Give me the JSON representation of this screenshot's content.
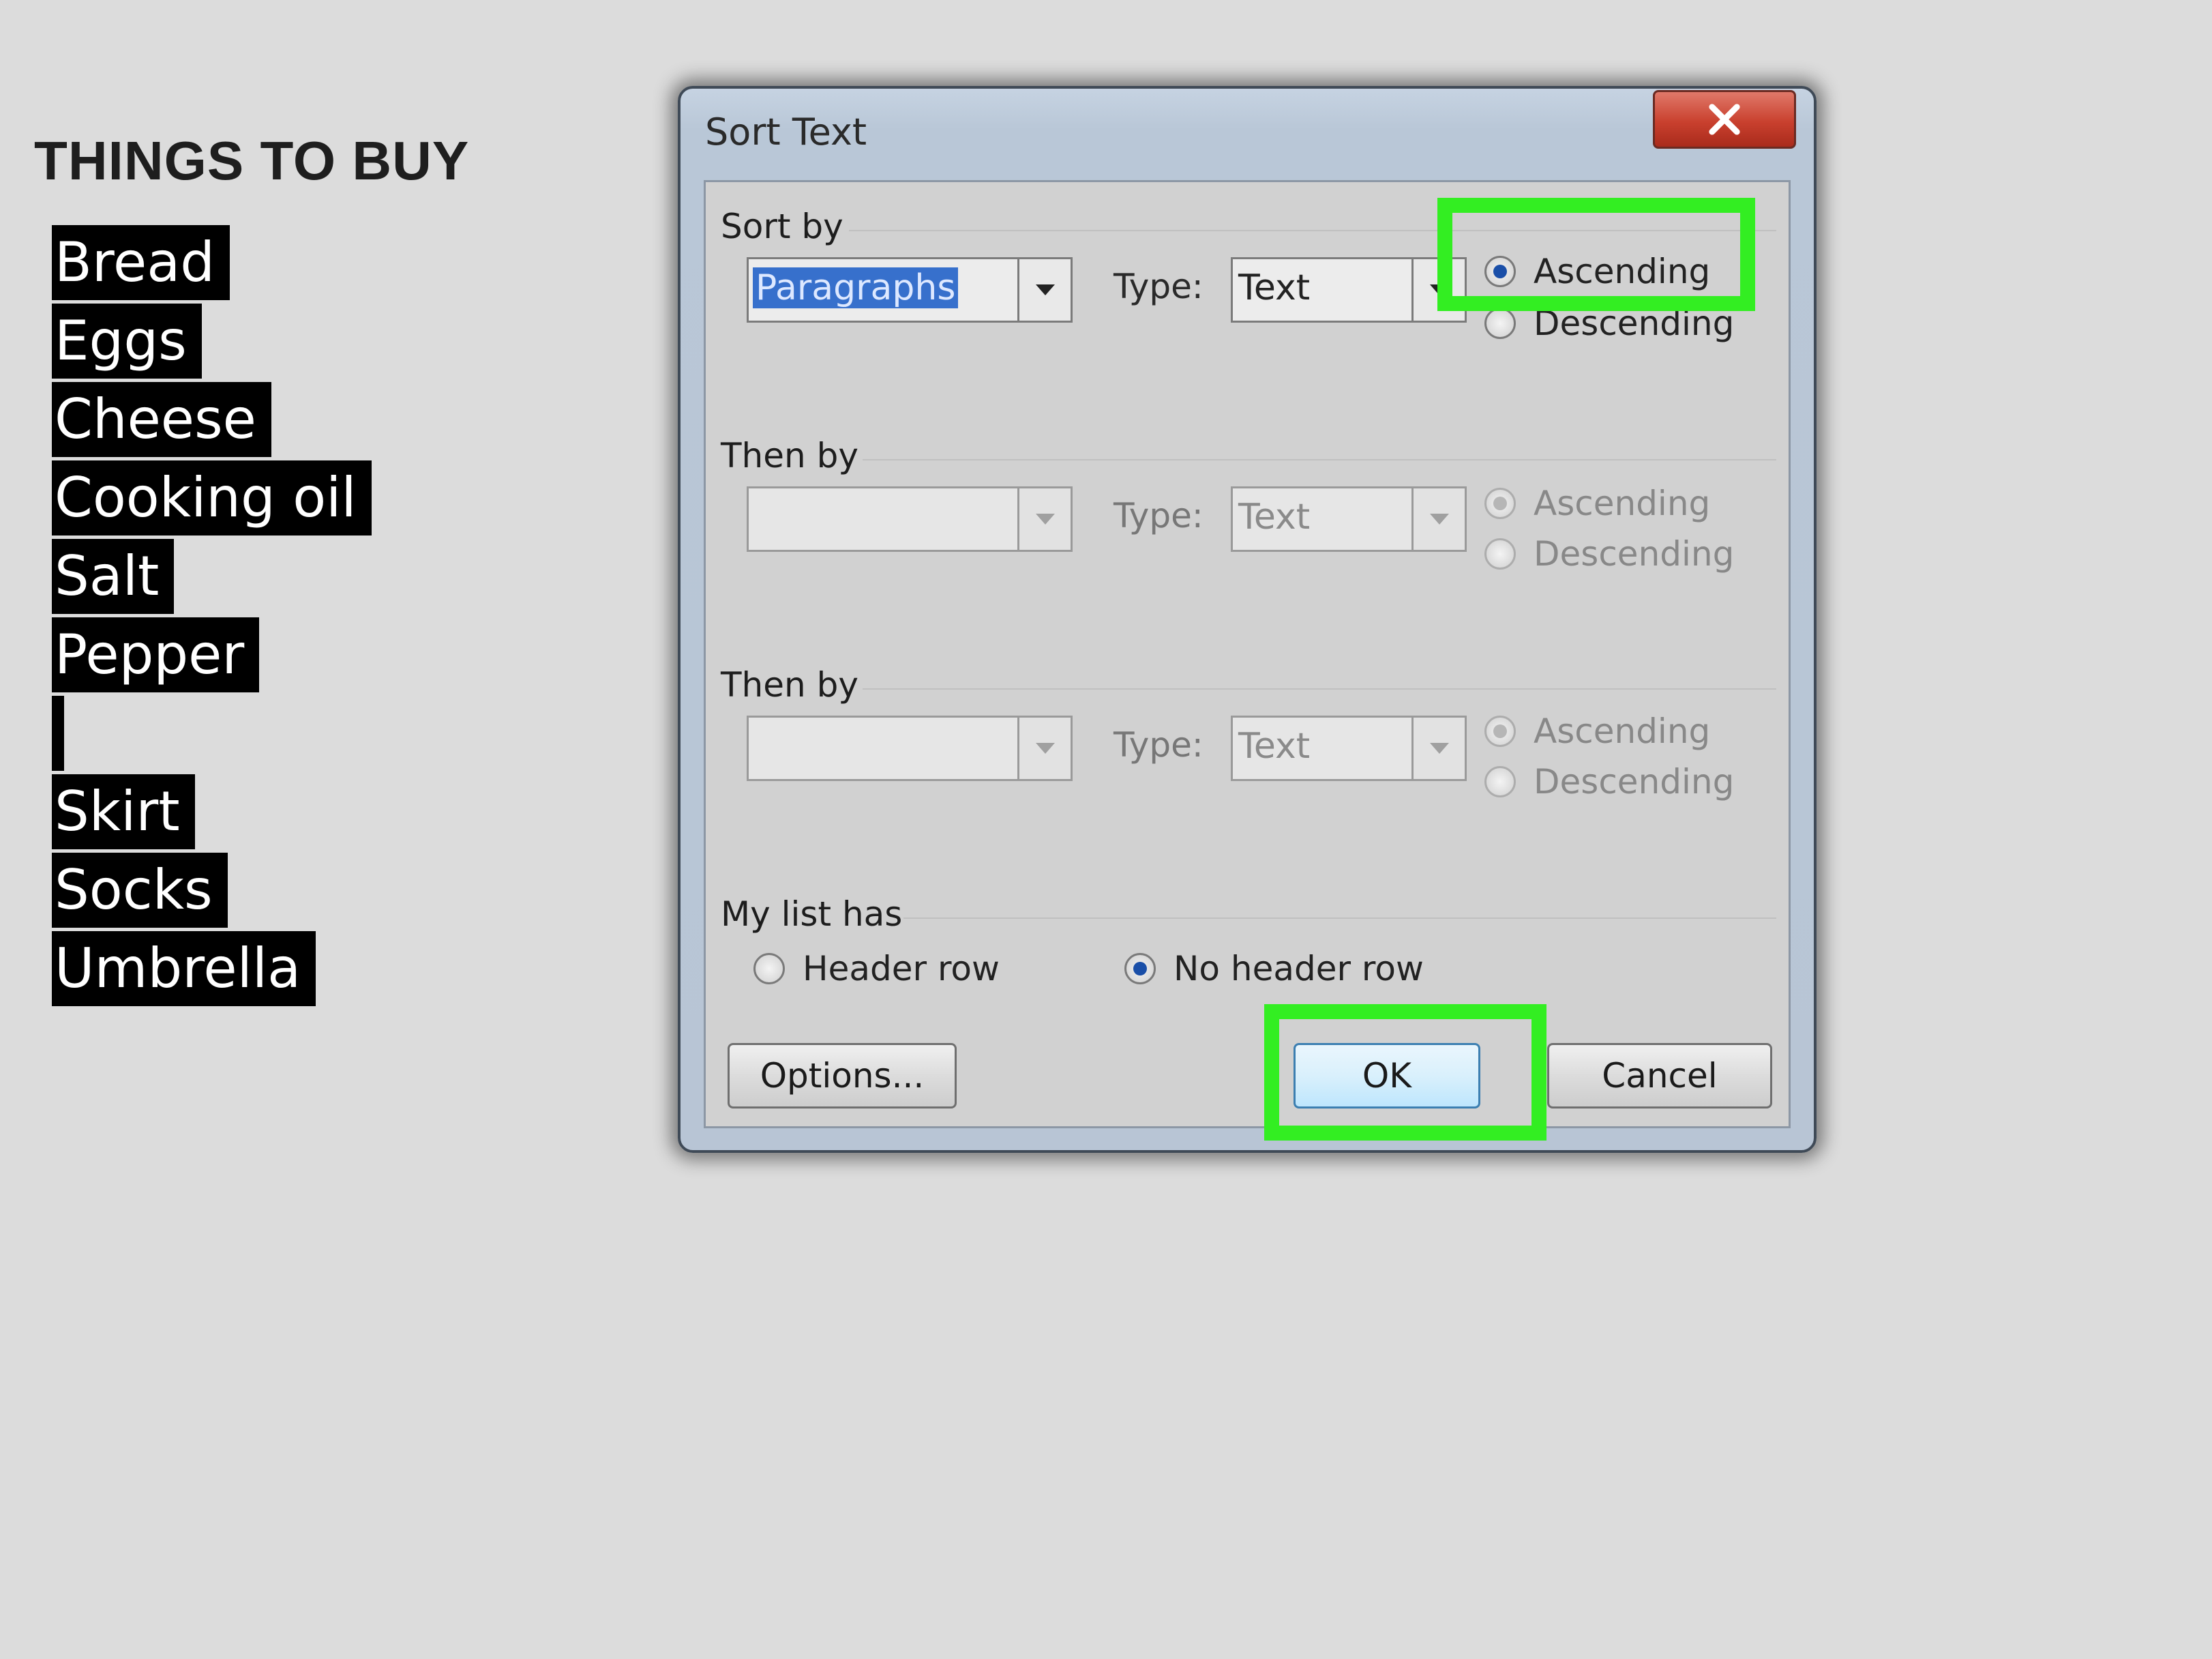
{
  "document": {
    "title": "THINGS TO BUY",
    "items": [
      "Bread",
      "Eggs",
      "Cheese",
      "Cooking oil",
      "Salt",
      "Pepper",
      "",
      "Skirt",
      "Socks",
      "Umbrella"
    ]
  },
  "dialog": {
    "title": "Sort Text",
    "close_icon": "close-x-icon",
    "sort_by": {
      "label": "Sort by",
      "field_value": "Paragraphs",
      "type_label": "Type:",
      "type_value": "Text",
      "ascending_label": "Ascending",
      "descending_label": "Descending",
      "selected": "Ascending"
    },
    "then_by_1": {
      "label": "Then by",
      "field_value": "",
      "type_label": "Type:",
      "type_value": "Text",
      "ascending_label": "Ascending",
      "descending_label": "Descending"
    },
    "then_by_2": {
      "label": "Then by",
      "field_value": "",
      "type_label": "Type:",
      "type_value": "Text",
      "ascending_label": "Ascending",
      "descending_label": "Descending"
    },
    "list_has": {
      "label": "My list has",
      "header_row_label": "Header row",
      "no_header_row_label": "No header row",
      "selected": "No header row"
    },
    "buttons": {
      "options": "Options...",
      "ok": "OK",
      "cancel": "Cancel"
    }
  },
  "colors": {
    "highlight": "#33ee22",
    "selection": "#3770cc",
    "close_button": "#c9402e"
  }
}
